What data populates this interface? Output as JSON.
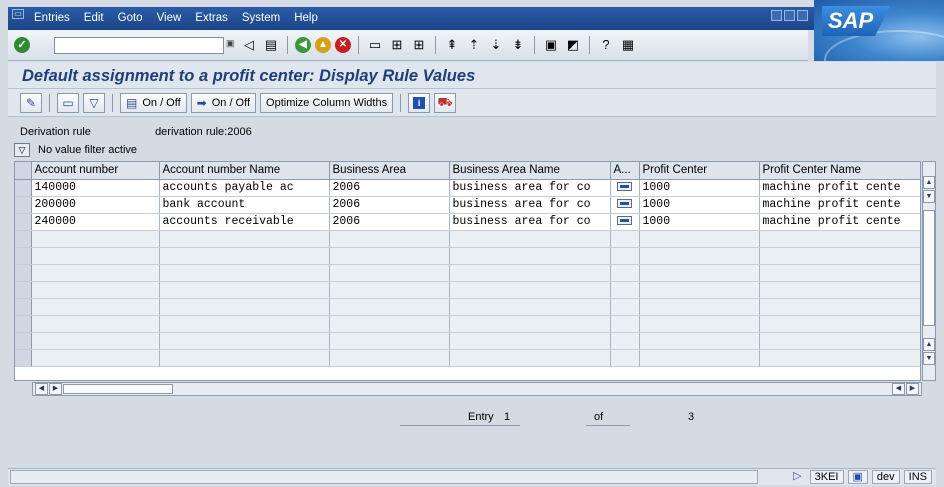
{
  "menu": {
    "items": [
      "Entries",
      "Edit",
      "Goto",
      "View",
      "Extras",
      "System",
      "Help"
    ]
  },
  "brand": {
    "logo": "SAP"
  },
  "title": "Default assignment to a profit center: Display Rule Values",
  "apptoolbar": {
    "toggle1_label": "On / Off",
    "toggle2_label": "On / Off",
    "optimize_label": "Optimize Column Widths"
  },
  "rule": {
    "label": "Derivation rule",
    "value": "derivation rule:2006"
  },
  "filter": {
    "text": "No value filter active"
  },
  "table": {
    "headers": [
      "Account number",
      "Account number Name",
      "Business Area",
      "Business Area Name",
      "A...",
      "Profit Center",
      "Profit Center Name"
    ],
    "rows": [
      [
        "140000",
        "accounts payable ac",
        "2006",
        "business area for co",
        "",
        "1000",
        "machine profit cente"
      ],
      [
        "200000",
        "bank account",
        "2006",
        "business area for co",
        "",
        "1000",
        "machine profit cente"
      ],
      [
        "240000",
        "accounts receivable",
        "2006",
        "business area for co",
        "",
        "1000",
        "machine profit cente"
      ]
    ]
  },
  "entry": {
    "label": "Entry",
    "current": "1",
    "of_label": "of",
    "total": "3"
  },
  "status": {
    "system": "3KEI",
    "client": "dev",
    "mode": "INS"
  }
}
